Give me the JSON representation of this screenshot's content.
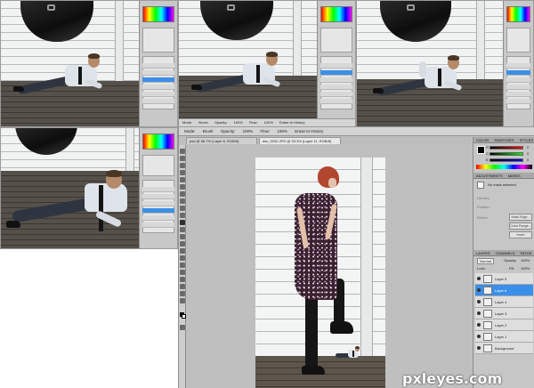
{
  "steps": [
    {
      "name": "step-1"
    },
    {
      "name": "step-2"
    },
    {
      "name": "step-3"
    },
    {
      "name": "step-4"
    }
  ],
  "step_options": {
    "mode_label": "Mode:",
    "mode_value": "Brush",
    "opacity_label": "Opacity:",
    "opacity_value": "100%",
    "flow_label": "Flow:",
    "flow_value": "100%",
    "erase_history": "Erase to History"
  },
  "workspace": {
    "options": {
      "mode_label": "Mode:",
      "mode_value": "Brush",
      "opacity_label": "Opacity:",
      "opacity_value": "100%",
      "flow_label": "Flow:",
      "flow_value": "100%",
      "erase_history": "Erase to History"
    },
    "tabs": [
      "psd @ 66.7% (Layer 6, RGB/8)",
      "dsc_0032.JPG @ 33.3% (Layer 11, RGB/8)"
    ],
    "panels": {
      "color_tabs": [
        "COLOR",
        "SWATCHES",
        "STYLES"
      ],
      "color_channels": [
        "R",
        "G",
        "B"
      ],
      "color_values": [
        "0",
        "0",
        "0"
      ],
      "mask_tabs": [
        "ADJUSTMENTS",
        "MASKS"
      ],
      "mask_status": "No mask selected",
      "density_label": "Density:",
      "feather_label": "Feather:",
      "refine_label": "Refine:",
      "mask_buttons": [
        "Mask Edge...",
        "Color Range...",
        "Invert"
      ],
      "layers_tabs": [
        "LAYERS",
        "CHANNELS",
        "PATHS"
      ],
      "blend_mode": "Normal",
      "opacity_label": "Opacity:",
      "opacity_value": "100%",
      "lock_label": "Lock:",
      "fill_label": "Fill:",
      "fill_value": "100%",
      "layers": [
        {
          "label": "Layer 5",
          "selected": false
        },
        {
          "label": "Layer 6",
          "selected": true
        },
        {
          "label": "Layer 4",
          "selected": false
        },
        {
          "label": "Layer 3",
          "selected": false
        },
        {
          "label": "Layer 2",
          "selected": false
        },
        {
          "label": "Layer 1",
          "selected": false
        },
        {
          "label": "Background",
          "selected": false
        }
      ]
    }
  },
  "watermark": "pxleyes.com",
  "colors": {
    "selection_blue": "#3a8fe8",
    "panel_gray": "#c6c6c6",
    "workspace_gray": "#bfbfbf"
  }
}
